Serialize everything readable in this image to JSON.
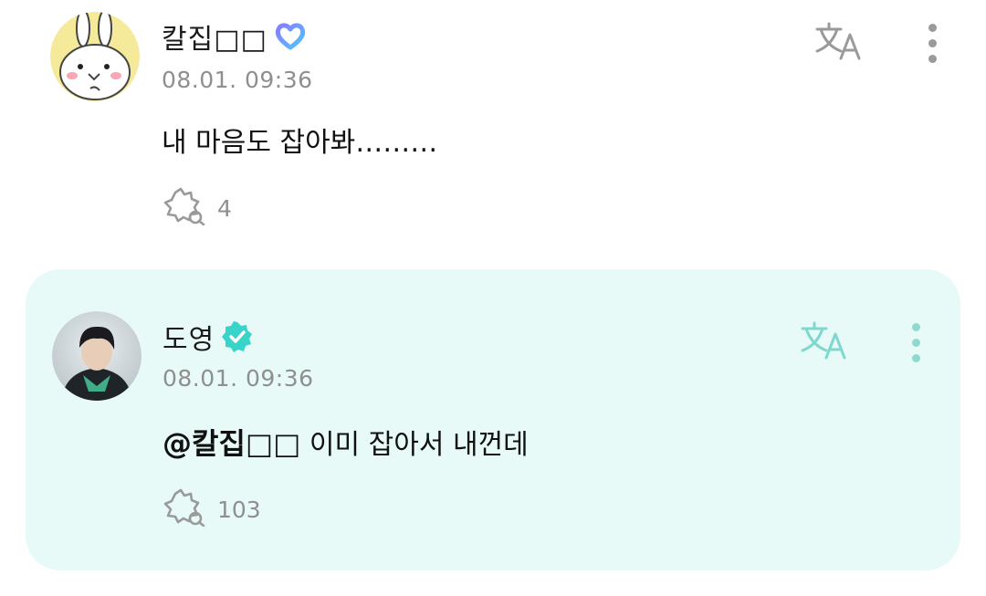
{
  "comments": [
    {
      "author": "칼집□□",
      "timestamp": "08.01. 09:36",
      "text": "내 마음도 잡아봐………",
      "reaction_count": "4",
      "avatar_icon": "rabbit-avatar",
      "badge_icon": "heart-badge-icon"
    },
    {
      "author": "도영",
      "timestamp": "08.01. 09:36",
      "mention": "@칼집□□",
      "text": "이미 잡아서 내껀데",
      "reaction_count": "103",
      "avatar_icon": "artist-photo-avatar",
      "badge_icon": "verified-badge-icon",
      "highlighted": true
    }
  ],
  "colors": {
    "highlight_background": "#e7faf7",
    "verified_badge": "#38d3c9",
    "heart_badge_gradient": [
      "#8a7cff",
      "#4dc6ff"
    ],
    "icon_gray": "#9a9a9a",
    "artist_icon": "#7fd8cf"
  }
}
